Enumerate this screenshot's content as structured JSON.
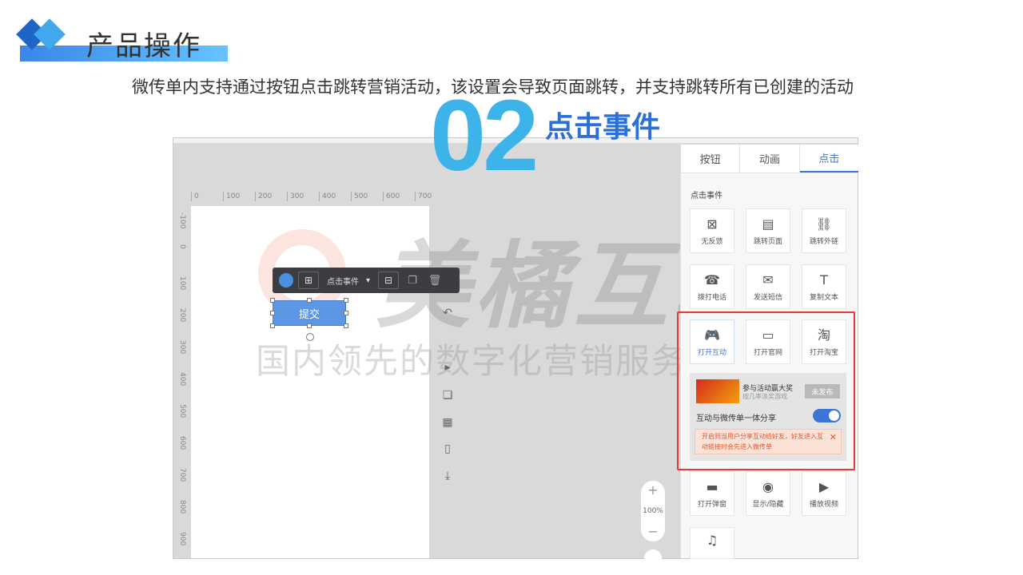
{
  "slide": {
    "title": "产品操作",
    "intro": "微传单内支持通过按钮点击跳转营销活动，该设置会导致页面跳转，并支持跳转所有已创建的活动",
    "section_number": "02",
    "section_label": "点击事件"
  },
  "watermark": {
    "brand": "美橘互联",
    "slogan": "国内领先的数字化营销服务商"
  },
  "editor": {
    "ruler_top": [
      "0",
      "100",
      "200",
      "300",
      "400",
      "500",
      "600",
      "700"
    ],
    "ruler_left": [
      "-100",
      "0",
      "100",
      "200",
      "300",
      "400",
      "500",
      "600",
      "700",
      "800",
      "900"
    ],
    "toolbar": {
      "event_select": "点击事件"
    },
    "submit_button": "提交",
    "zoom": {
      "plus": "+",
      "level": "100%",
      "minus": "−"
    }
  },
  "panel": {
    "tabs": [
      "按钮",
      "动画",
      "点击"
    ],
    "active_tab": "点击",
    "section_label": "点击事件",
    "events": [
      {
        "label": "无反馈",
        "icon": "no-feedback-icon"
      },
      {
        "label": "跳转页面",
        "icon": "page-icon"
      },
      {
        "label": "跳转外链",
        "icon": "link-icon"
      },
      {
        "label": "拨打电话",
        "icon": "phone-icon"
      },
      {
        "label": "发送短信",
        "icon": "sms-icon"
      },
      {
        "label": "复制文本",
        "icon": "copy-text-icon"
      },
      {
        "label": "打开互动",
        "icon": "gamepad-icon"
      },
      {
        "label": "打开官网",
        "icon": "website-icon"
      },
      {
        "label": "打开淘宝",
        "icon": "taobao-icon"
      },
      {
        "label": "打开弹窗",
        "icon": "popup-icon"
      },
      {
        "label": "显示/隐藏",
        "icon": "eye-icon"
      },
      {
        "label": "播放视频",
        "icon": "play-icon"
      },
      {
        "label": "",
        "icon": "music-icon"
      }
    ],
    "interaction": {
      "title": "参与活动赢大奖",
      "desc": "按几率派奖游戏",
      "status": "未发布",
      "share_label": "互动与微传单一体分享",
      "notice": "开启则当用户分享互动给好友，好友进入互动链接时会先进入微传单"
    },
    "colors": {
      "accent": "#3c74d8",
      "highlight": "#e53935"
    }
  }
}
